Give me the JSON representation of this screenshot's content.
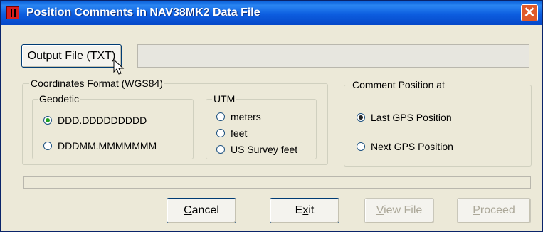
{
  "window": {
    "title": "Position Comments in NAV38MK2 Data File",
    "close_glyph": "✕"
  },
  "output": {
    "button_prefix": "O",
    "button_rest": "utput File (TXT)",
    "path_value": ""
  },
  "coords": {
    "legend": "Coordinates Format (WGS84)",
    "geodetic": {
      "legend": "Geodetic",
      "options": [
        "DDD.DDDDDDDDD",
        "DDDMM.MMMMMMM"
      ],
      "selected": 0
    },
    "utm": {
      "legend": "UTM",
      "options": [
        "meters",
        "feet",
        "US Survey feet"
      ]
    }
  },
  "comment": {
    "legend": "Comment Position at",
    "options": [
      "Last GPS Position",
      "Next GPS Position"
    ],
    "selected": 0
  },
  "status_value": "",
  "buttons": {
    "cancel": {
      "prefix": "C",
      "rest": "ancel"
    },
    "exit": {
      "a": "E",
      "b": "x",
      "c": "it"
    },
    "view": {
      "prefix": "V",
      "rest": "iew File"
    },
    "proceed": {
      "prefix": "P",
      "rest": "roceed"
    }
  },
  "icons": [
    "app-icon",
    "close-icon",
    "mouse-pointer-icon"
  ]
}
